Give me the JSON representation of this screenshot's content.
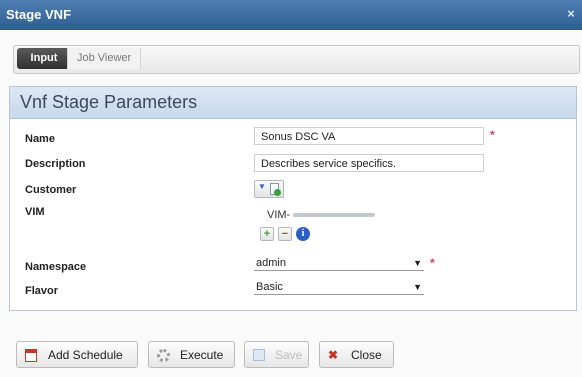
{
  "window": {
    "title": "Stage VNF",
    "close_glyph": "×"
  },
  "tabs": [
    {
      "label": "Input",
      "active": true
    },
    {
      "label": "Job Viewer",
      "active": false
    }
  ],
  "panel": {
    "title": "Vnf Stage Parameters"
  },
  "form": {
    "name": {
      "label": "Name",
      "value": "Sonus DSC VA",
      "required": true
    },
    "description": {
      "label": "Description",
      "value": "Describes service specifics."
    },
    "customer": {
      "label": "Customer"
    },
    "vim": {
      "label": "VIM",
      "value": "VIM-"
    },
    "namespace": {
      "label": "Namespace",
      "value": "admin",
      "required": true
    },
    "flavor": {
      "label": "Flavor",
      "value": "Basic"
    }
  },
  "buttons": {
    "add_schedule": "Add Schedule",
    "execute": "Execute",
    "save": "Save",
    "close": "Close"
  },
  "colors": {
    "titlebar": "#3a6aa0",
    "panel_header": "#d2e1f1",
    "required": "#d9434b",
    "add_green": "#3aa040",
    "remove_red": "#d03a3a",
    "info_blue": "#2a5fc4"
  }
}
